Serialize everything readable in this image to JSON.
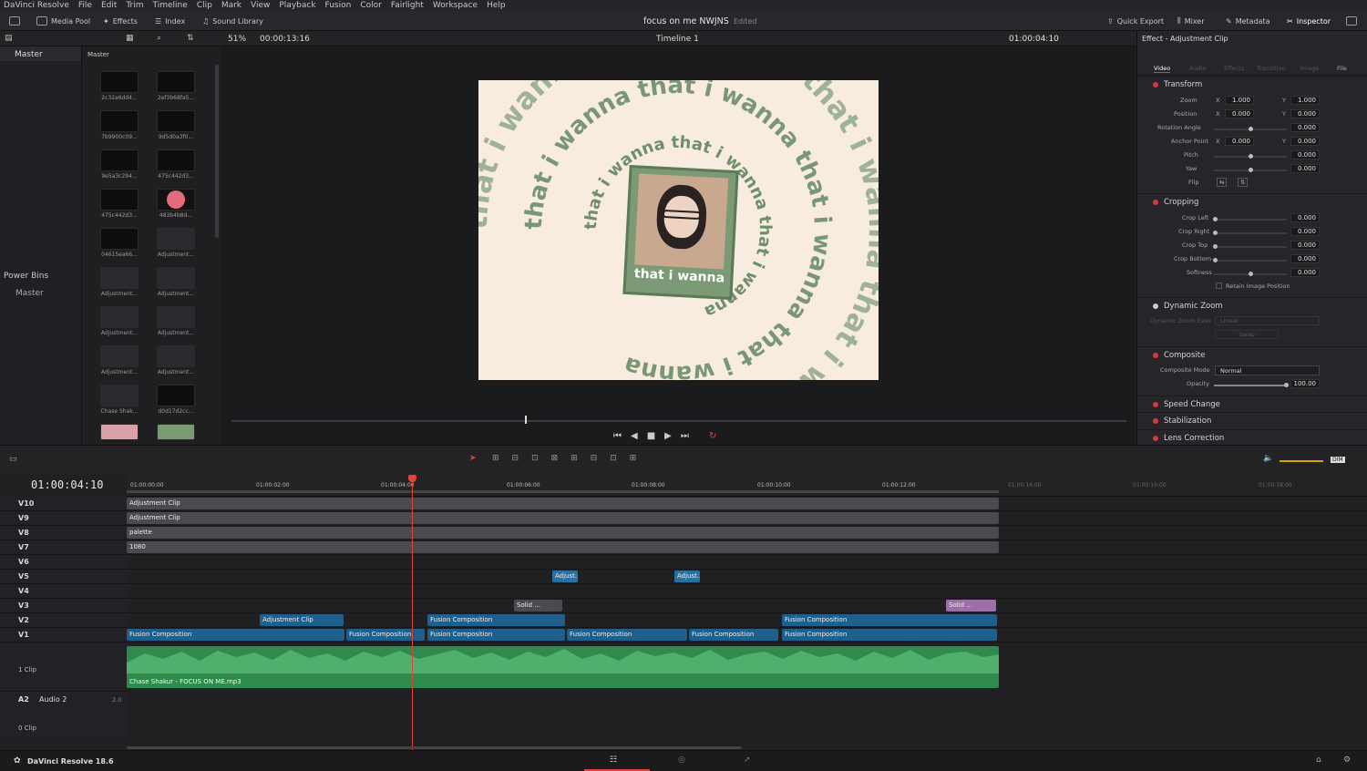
{
  "menu": [
    "DaVinci Resolve",
    "File",
    "Edit",
    "Trim",
    "Timeline",
    "Clip",
    "Mark",
    "View",
    "Playback",
    "Fusion",
    "Color",
    "Fairlight",
    "Workspace",
    "Help"
  ],
  "toolbar": {
    "media_pool": "Media Pool",
    "effects": "Effects",
    "index": "Index",
    "sound_library": "Sound Library",
    "project_title": "focus on me NWJNS",
    "edited": "Edited",
    "quick_export": "Quick Export",
    "mixer": "Mixer",
    "metadata": "Metadata",
    "inspector": "Inspector"
  },
  "viewer": {
    "zoom": "51%",
    "source_timecode": "00:00:13:16",
    "timeline_name": "Timeline 1",
    "timecode": "01:00:04:10",
    "spiral_text": "that i wanna",
    "frame_caption": "that i wanna"
  },
  "bins": {
    "master_header": "Master",
    "thumb_header": "Master",
    "power_bins": "Power Bins",
    "power_master": "Master"
  },
  "thumbs": [
    "2c32a6dd4...",
    "2ef3b68fa5...",
    "7b9900c09...",
    "9d5d0a3f0...",
    "9e5a3c294...",
    "475c442d3...",
    "475c442d3...",
    "483b4b8d...",
    "04615ea66...",
    "Adjustment...",
    "Adjustment...",
    "Adjustment...",
    "Adjustment...",
    "Adjustment...",
    "Adjustment...",
    "Adjustment...",
    "Chase Shak...",
    "d0d17d2cc..."
  ],
  "inspector": {
    "title": "Effect - Adjustment Clip",
    "tabs": [
      "Video",
      "Audio",
      "Effects",
      "Transition",
      "Image",
      "File"
    ],
    "transform": "Transform",
    "zoom": "Zoom",
    "zoom_x": "1.000",
    "zoom_y": "1.000",
    "position": "Position",
    "pos_x": "0.000",
    "pos_y": "0.000",
    "rotation": "Rotation Angle",
    "rotation_val": "0.000",
    "anchor": "Anchor Point",
    "anchor_x": "0.000",
    "anchor_y": "0.000",
    "pitch": "Pitch",
    "pitch_val": "0.000",
    "yaw": "Yaw",
    "yaw_val": "0.000",
    "flip": "Flip",
    "cropping": "Cropping",
    "crop_left": "Crop Left",
    "crop_right": "Crop Right",
    "crop_top": "Crop Top",
    "crop_bottom": "Crop Bottom",
    "softness": "Softness",
    "crop_val": "0.000",
    "retain": "Retain Image Position",
    "dynamic_zoom": "Dynamic Zoom",
    "dz_ease": "Dynamic Zoom Ease",
    "dz_linear": "Linear",
    "swap": "Swap",
    "composite": "Composite",
    "comp_mode": "Composite Mode",
    "comp_mode_val": "Normal",
    "opacity": "Opacity",
    "opacity_val": "100.00",
    "speed_change": "Speed Change",
    "stabilization": "Stabilization",
    "lens_correction": "Lens Correction"
  },
  "timeline": {
    "timecode": "01:00:04:10",
    "ruler": [
      "01:00:00:00",
      "01:00:02:00",
      "01:00:04:00",
      "01:00:06:00",
      "01:00:08:00",
      "01:00:10:00",
      "01:00:12:00",
      "01:00:14:00",
      "01:00:16:00",
      "01:00:18:00"
    ],
    "tracks": [
      "V10",
      "V9",
      "V8",
      "V7",
      "V6",
      "V5",
      "V4",
      "V3",
      "V2",
      "V1"
    ],
    "a1_clips": "1 Clip",
    "a2": "A2",
    "a2_name": "Audio 2",
    "a2_level": "2.0",
    "a2_clips": "0 Clip",
    "audio_clip": "Chase Shakur - FOCUS ON ME.mp3",
    "clips": {
      "adj": "Adjustment Clip",
      "palette": "palette",
      "p1080": "1080",
      "adjust_short": "Adjust...",
      "solid_short": "Solid ...",
      "fusion": "Fusion Composition"
    },
    "dim": "DIM"
  },
  "footer": {
    "app": "DaVinci Resolve 18.6"
  }
}
